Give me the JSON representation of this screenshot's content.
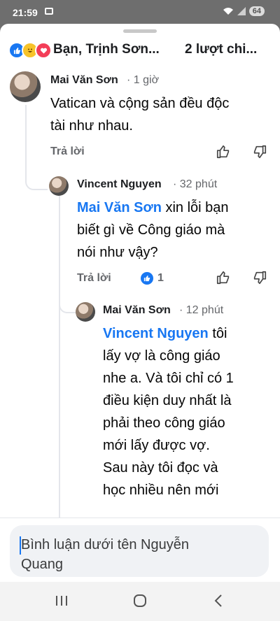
{
  "status": {
    "time": "21:59",
    "battery": "64"
  },
  "header": {
    "reactions": [
      "like",
      "haha",
      "love"
    ],
    "reactors": "Bạn, Trịnh Sơn...",
    "shares": "2 lượt chi..."
  },
  "comments": [
    {
      "author": "Mai Văn Sơn",
      "time": "· 1 giờ",
      "text_lines": [
        "Vatican và cộng sản đều độc",
        "tài  như nhau."
      ],
      "reply_label": "Trả lời"
    },
    {
      "author": "Vincent Nguyen",
      "time": "· 32 phút",
      "mention": "Mai Văn Sơn",
      "text_lines": [
        " xin lỗi bạn",
        "biết gì về Công giáo mà",
        "nói như vậy?"
      ],
      "reply_label": "Trả lời",
      "like_count": "1"
    },
    {
      "author": "Mai Văn Sơn",
      "time": "· 12 phút",
      "mention": "Vincent Nguyen",
      "text_lines": [
        " tôi",
        "lấy vợ là công giáo",
        "nhe a. Và tôi chỉ có 1",
        "điều kiện duy nhất là",
        "phải theo công giáo",
        "mới lấy được vợ.",
        "Sau này tôi đọc và",
        "học nhiều nên mới"
      ]
    }
  ],
  "composer": {
    "placeholder_line1": "Bình luận dưới tên Nguyễn",
    "placeholder_line2": "Quang"
  },
  "nav": {
    "recents": "|||",
    "home": "○",
    "back": "<"
  }
}
